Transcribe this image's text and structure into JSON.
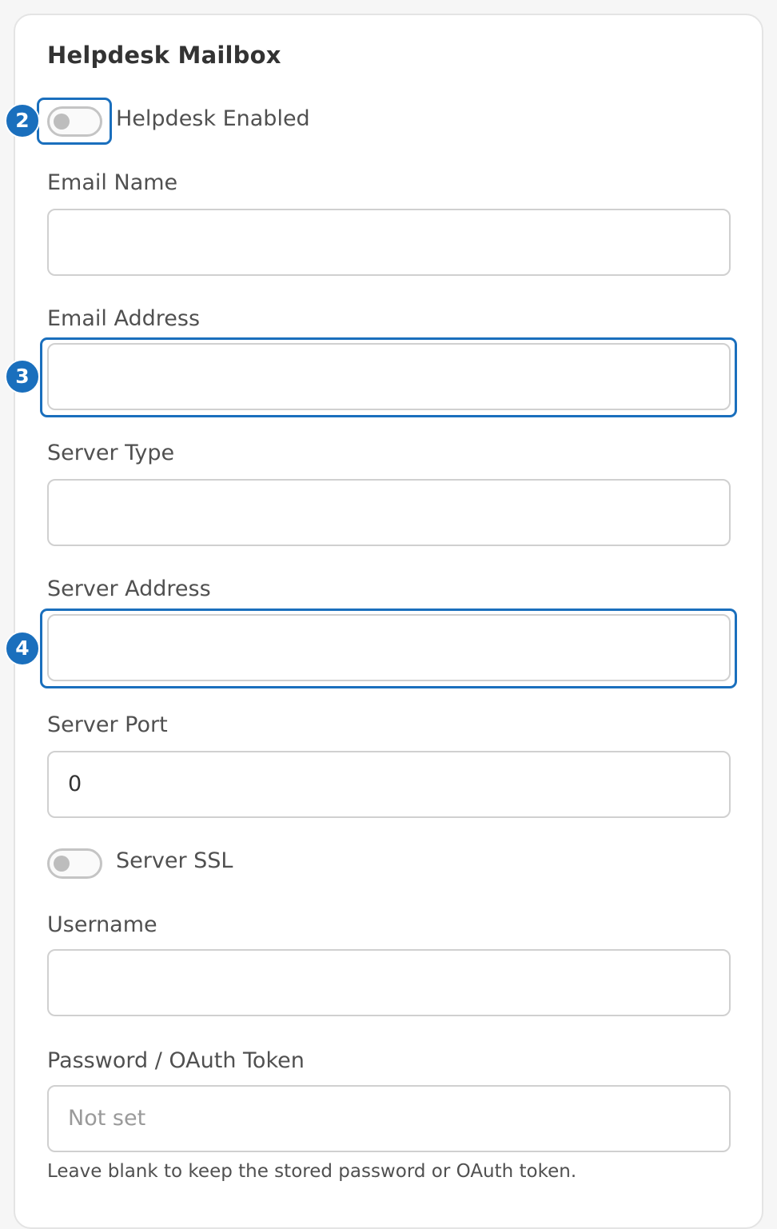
{
  "section": {
    "title": "Helpdesk Mailbox"
  },
  "helpdesk_enabled": {
    "label": "Helpdesk Enabled",
    "on": false
  },
  "email_name": {
    "label": "Email Name",
    "value": ""
  },
  "email_address": {
    "label": "Email Address",
    "value": ""
  },
  "server_type": {
    "label": "Server Type",
    "value": ""
  },
  "server_address": {
    "label": "Server Address",
    "value": ""
  },
  "server_port": {
    "label": "Server Port",
    "value": "0"
  },
  "server_ssl": {
    "label": "Server SSL",
    "on": false
  },
  "username": {
    "label": "Username",
    "value": ""
  },
  "password": {
    "label": "Password / OAuth Token",
    "placeholder": "Not set",
    "help": "Leave blank to keep the stored password or OAuth token."
  },
  "annotations": {
    "badge_2": "2",
    "badge_3": "3",
    "badge_4": "4"
  },
  "colors": {
    "accent": "#1a6fbd",
    "border": "#d0d0d0"
  }
}
